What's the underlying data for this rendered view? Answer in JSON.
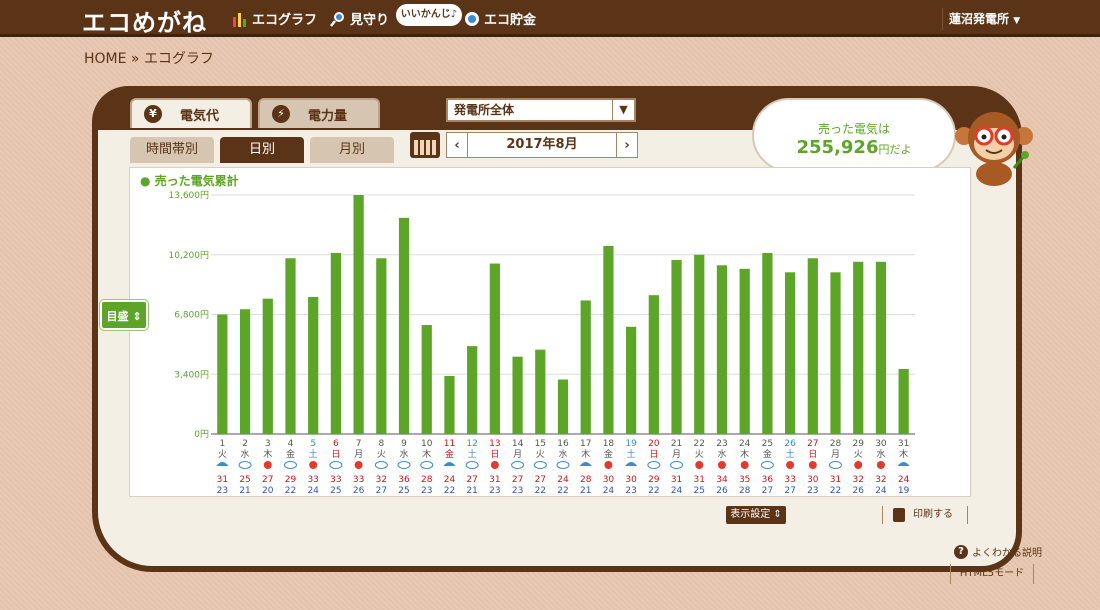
{
  "app": {
    "logo": "エコめがね",
    "nav": [
      {
        "label": "エコグラフ",
        "icon": "bar-chart-icon"
      },
      {
        "label": "見守り",
        "icon": "magnifier-icon"
      },
      {
        "label": "エコ貯金",
        "icon": "piggy-bank-icon"
      }
    ],
    "bubble": "いいかんじ♪",
    "plant_selector": "蓮沼発電所"
  },
  "breadcrumb": "HOME » エコグラフ",
  "tabs": {
    "main": [
      {
        "label": "電気代",
        "icon": "yen-icon",
        "active": true
      },
      {
        "label": "電力量",
        "icon": "lightning-icon",
        "active": false
      }
    ],
    "sub": [
      {
        "label": "時間帯別",
        "active": false
      },
      {
        "label": "日別",
        "active": true
      },
      {
        "label": "月別",
        "active": false
      }
    ]
  },
  "scope_dropdown": "発電所全体",
  "month_nav": {
    "prev": "‹",
    "label": "2017年8月",
    "next": "›"
  },
  "summary": {
    "line1": "売った電気は",
    "value": "255,926",
    "suffix": "円だよ"
  },
  "side_button": "目盛",
  "footer": {
    "display_settings": "表示設定",
    "print": "印刷する",
    "help": "よくわかる説明",
    "html5": "HTML5モード"
  },
  "colors": {
    "bar": "#5da529",
    "brown": "#5b3418",
    "holiday_red": "#c9151e",
    "saturday_blue": "#3a8bd6"
  },
  "chart_data": {
    "type": "bar",
    "title": "売った電気累計",
    "y_ticks": [
      "0円",
      "3,400円",
      "6,800円",
      "10,200円",
      "13,600円"
    ],
    "ylim": [
      0,
      13600
    ],
    "categories": [
      "1",
      "2",
      "3",
      "4",
      "5",
      "6",
      "7",
      "8",
      "9",
      "10",
      "11",
      "12",
      "13",
      "14",
      "15",
      "16",
      "17",
      "18",
      "19",
      "20",
      "21",
      "22",
      "23",
      "24",
      "25",
      "26",
      "27",
      "28",
      "29",
      "30",
      "31"
    ],
    "weekdays": [
      "火",
      "水",
      "木",
      "金",
      "土",
      "日",
      "月",
      "火",
      "水",
      "木",
      "金",
      "土",
      "日",
      "月",
      "火",
      "水",
      "木",
      "金",
      "土",
      "日",
      "月",
      "火",
      "水",
      "木",
      "金",
      "土",
      "日",
      "月",
      "火",
      "水",
      "木"
    ],
    "day_color": [
      "n",
      "n",
      "n",
      "n",
      "sat",
      "hol",
      "n",
      "n",
      "n",
      "n",
      "hol",
      "sat",
      "hol",
      "n",
      "n",
      "n",
      "n",
      "n",
      "sat",
      "hol",
      "n",
      "n",
      "n",
      "n",
      "n",
      "sat",
      "hol",
      "n",
      "n",
      "n",
      "n"
    ],
    "weather": [
      "rain-icon",
      "cloud-icon",
      "sun-icon",
      "cloud-icon",
      "sun-icon",
      "cloud-icon",
      "sun-icon",
      "cloud-icon",
      "cloud-icon",
      "cloud-icon",
      "rain-icon",
      "cloud-icon",
      "sun-icon",
      "cloud-icon",
      "cloud-icon",
      "cloud-icon",
      "rain-icon",
      "sun-icon",
      "rain-icon",
      "cloud-icon",
      "cloud-icon",
      "sun-icon",
      "sun-icon",
      "sun-icon",
      "cloud-icon",
      "sun-icon",
      "sun-icon",
      "cloud-icon",
      "sun-icon",
      "sun-icon",
      "rain-icon"
    ],
    "temp_high": [
      "31",
      "25",
      "27",
      "29",
      "33",
      "33",
      "33",
      "32",
      "36",
      "28",
      "24",
      "27",
      "31",
      "27",
      "27",
      "24",
      "28",
      "30",
      "30",
      "29",
      "31",
      "31",
      "34",
      "35",
      "36",
      "33",
      "30",
      "31",
      "32",
      "32",
      "24"
    ],
    "temp_low": [
      "23",
      "21",
      "20",
      "22",
      "24",
      "25",
      "26",
      "27",
      "25",
      "23",
      "22",
      "21",
      "23",
      "23",
      "22",
      "22",
      "21",
      "24",
      "23",
      "22",
      "24",
      "25",
      "26",
      "28",
      "27",
      "27",
      "23",
      "22",
      "26",
      "24",
      "19"
    ],
    "values": [
      6800,
      7100,
      7700,
      10000,
      7800,
      10300,
      13600,
      10000,
      12300,
      6200,
      3300,
      5000,
      9700,
      4400,
      4800,
      3100,
      7600,
      10700,
      6100,
      7900,
      9900,
      10200,
      9600,
      9400,
      10300,
      9200,
      10000,
      9200,
      9800,
      9800,
      3700
    ]
  }
}
